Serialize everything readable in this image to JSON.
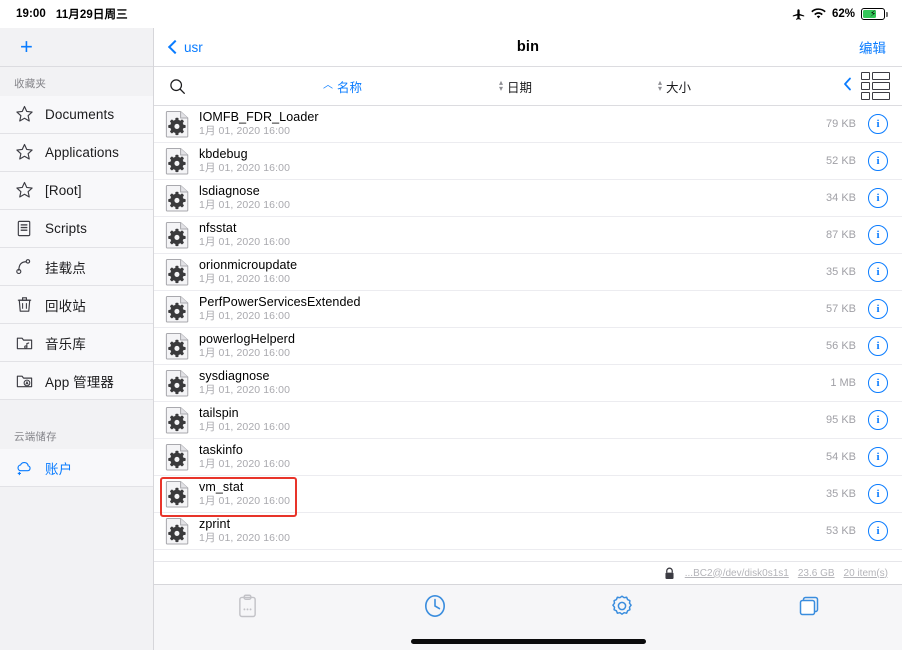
{
  "status_bar": {
    "time": "19:00",
    "date": "11月29日周三",
    "airplane_icon": "airplane-icon",
    "wifi_icon": "wifi-icon",
    "battery_percent": "62%",
    "battery_charging": true
  },
  "sidebar": {
    "add_button": "+",
    "sections": [
      {
        "header": "收藏夹",
        "items": [
          {
            "label": "Documents",
            "icon": "star-icon"
          },
          {
            "label": "Applications",
            "icon": "star-icon"
          },
          {
            "label": "[Root]",
            "icon": "star-icon"
          },
          {
            "label": "Scripts",
            "icon": "script-icon"
          },
          {
            "label": "挂载点",
            "icon": "mount-point-icon"
          },
          {
            "label": "回收站",
            "icon": "trash-icon"
          },
          {
            "label": "音乐库",
            "icon": "music-folder-icon"
          },
          {
            "label": "App 管理器",
            "icon": "app-folder-icon"
          }
        ]
      },
      {
        "header": "云端储存",
        "items": [
          {
            "label": "账户",
            "icon": "cloud-add-icon"
          }
        ]
      }
    ]
  },
  "navbar": {
    "back_label": "usr",
    "title": "bin",
    "edit_label": "编辑"
  },
  "columns": {
    "search_icon": "search-icon",
    "name": "名称",
    "date": "日期",
    "size": "大小",
    "sort_active": "name",
    "sort_direction": "ascending",
    "collapse_icon": "chevron-left-icon",
    "view_icon": "grid-view-icon"
  },
  "files": [
    {
      "name": "IOMFB_FDR_Loader",
      "date": "1月 01, 2020 16:00",
      "size": "79 KB",
      "highlighted": false
    },
    {
      "name": "kbdebug",
      "date": "1月 01, 2020 16:00",
      "size": "52 KB",
      "highlighted": false
    },
    {
      "name": "lsdiagnose",
      "date": "1月 01, 2020 16:00",
      "size": "34 KB",
      "highlighted": false
    },
    {
      "name": "nfsstat",
      "date": "1月 01, 2020 16:00",
      "size": "87 KB",
      "highlighted": false
    },
    {
      "name": "orionmicroupdate",
      "date": "1月 01, 2020 16:00",
      "size": "35 KB",
      "highlighted": false
    },
    {
      "name": "PerfPowerServicesExtended",
      "date": "1月 01, 2020 16:00",
      "size": "57 KB",
      "highlighted": false
    },
    {
      "name": "powerlogHelperd",
      "date": "1月 01, 2020 16:00",
      "size": "56 KB",
      "highlighted": false
    },
    {
      "name": "sysdiagnose",
      "date": "1月 01, 2020 16:00",
      "size": "1 MB",
      "highlighted": false
    },
    {
      "name": "tailspin",
      "date": "1月 01, 2020 16:00",
      "size": "95 KB",
      "highlighted": false
    },
    {
      "name": "taskinfo",
      "date": "1月 01, 2020 16:00",
      "size": "54 KB",
      "highlighted": false
    },
    {
      "name": "vm_stat",
      "date": "1月 01, 2020 16:00",
      "size": "35 KB",
      "highlighted": true
    },
    {
      "name": "zprint",
      "date": "1月 01, 2020 16:00",
      "size": "53 KB",
      "highlighted": false
    }
  ],
  "path_bar": {
    "lock_icon": "lock-icon",
    "mount": "...BC2@/dev/disk0s1s1",
    "capacity": "23.6 GB",
    "item_count": "20 item(s)"
  },
  "tab_bar": {
    "tabs": [
      {
        "icon": "clipboard-icon",
        "active": false
      },
      {
        "icon": "clock-icon",
        "active": true
      },
      {
        "icon": "gear-icon",
        "active": true
      },
      {
        "icon": "windows-icon",
        "active": true
      }
    ]
  },
  "colors": {
    "accent": "#0a7cff",
    "highlight": "#e8342a",
    "battery_green": "#34c759",
    "muted": "#a9a9ae"
  }
}
